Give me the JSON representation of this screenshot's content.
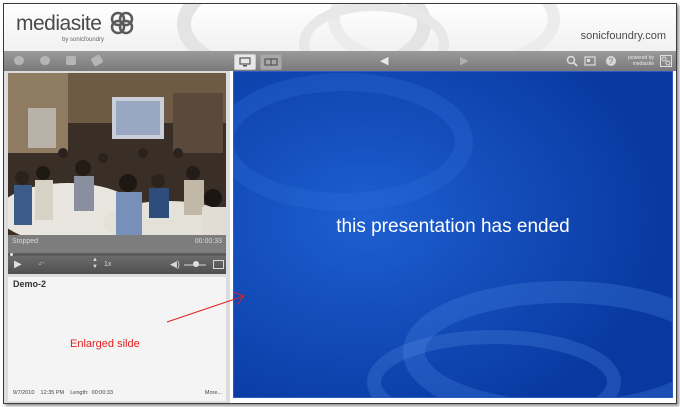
{
  "header": {
    "logo_text": "mediasite",
    "logo_sub": "by sonicfoundry",
    "site_text": "sonicfoundry.com"
  },
  "toolbar": {
    "left_icons": [
      "chat-icon",
      "comment-icon",
      "mail-icon",
      "link-icon"
    ],
    "view_buttons": [
      "slide-view-icon",
      "video-view-icon"
    ],
    "prev_icon": "left-arrow-icon",
    "next_icon": "right-arrow-icon",
    "right_icons": [
      "search-icon",
      "layout-icon",
      "help-icon"
    ],
    "powered_line1": "powered by",
    "powered_line2": "mediasite"
  },
  "player": {
    "status": "Stopped",
    "time": "00:00:33",
    "speed": "1x",
    "play_icon": "play-icon",
    "volume_icon": "volume-icon",
    "fullscreen_icon": "fullscreen-icon"
  },
  "info": {
    "title": "Demo-2",
    "date": "9/7/2010",
    "clock": "12:35 PM",
    "length_label": "Length:",
    "length": "00:00:33",
    "more": "More..."
  },
  "slide": {
    "message": "this presentation has ended"
  },
  "annotation": {
    "text": "Enlarged silde"
  },
  "colors": {
    "slide_bg": "#0a3ea3",
    "toolbar_bg": "#8a8a8a",
    "annotation": "#e02020"
  }
}
